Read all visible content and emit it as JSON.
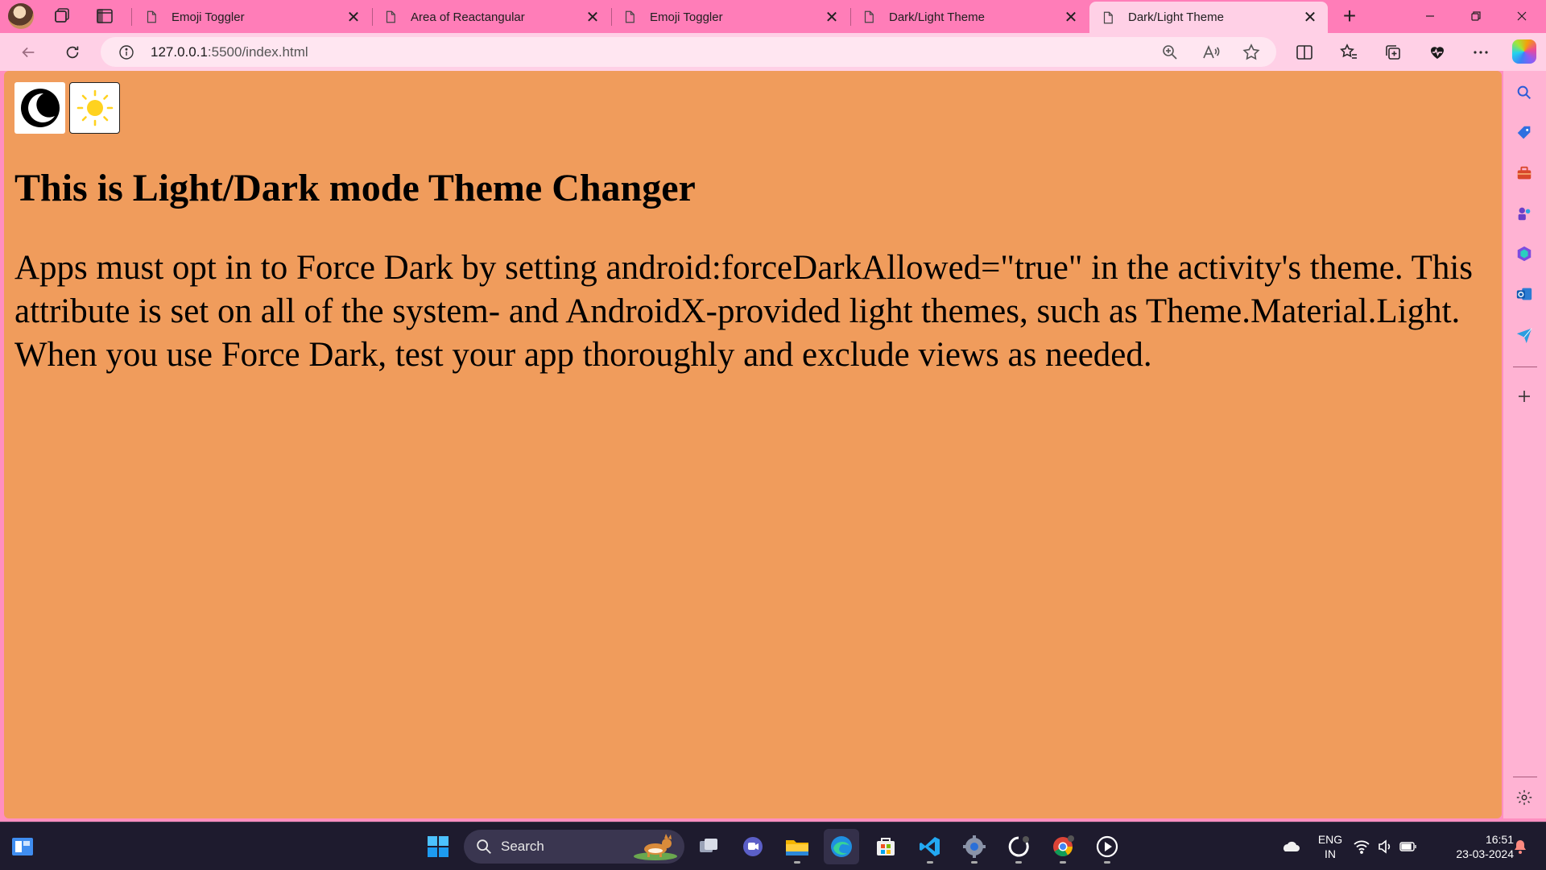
{
  "browser": {
    "tabs": [
      {
        "title": "Emoji Toggler",
        "active": false
      },
      {
        "title": "Area of Reactangular",
        "active": false
      },
      {
        "title": "Emoji Toggler",
        "active": false
      },
      {
        "title": "Dark/Light Theme",
        "active": false
      },
      {
        "title": "Dark/Light Theme",
        "active": true
      }
    ],
    "new_tab_label": "+",
    "close_glyph": "✕",
    "address": {
      "host": "127.0.0.1",
      "rest": ":5500/index.html"
    }
  },
  "page": {
    "moon_button_icon": "moon-icon",
    "sun_button_icon": "sun-icon",
    "heading": "This is Light/Dark mode Theme Changer",
    "paragraph": "Apps must opt in to Force Dark by setting android:forceDarkAllowed=\"true\" in the activity's theme. This attribute is set on all of the system- and AndroidX-provided light themes, such as Theme.Material.Light. When you use Force Dark, test your app thoroughly and exclude views as needed.",
    "background_color": "#f09c5c"
  },
  "taskbar": {
    "search_label": "Search",
    "language": {
      "line1": "ENG",
      "line2": "IN"
    },
    "clock": {
      "time": "16:51",
      "date": "23-03-2024"
    }
  },
  "colors": {
    "tabstrip": "#ff7db8",
    "toolbar": "#ffd0e6",
    "sidebar": "#ffb3d3",
    "taskbar": "#1e1b2e"
  }
}
